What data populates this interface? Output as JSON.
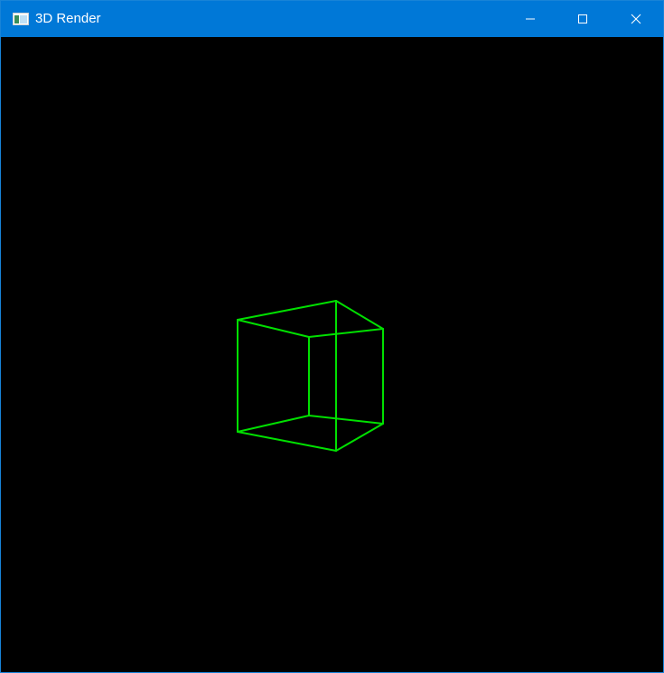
{
  "window": {
    "title": "3D Render",
    "app_icon": "window-app-icon",
    "controls": {
      "minimize_icon": "minimize-icon",
      "maximize_icon": "maximize-icon",
      "close_icon": "close-icon"
    },
    "colors": {
      "titlebar": "#0078d7",
      "title_text": "#ffffff",
      "canvas_background": "#000000"
    }
  },
  "scene": {
    "object": "wireframe-cube",
    "stroke_color": "#00e000",
    "edge_count": 12
  }
}
